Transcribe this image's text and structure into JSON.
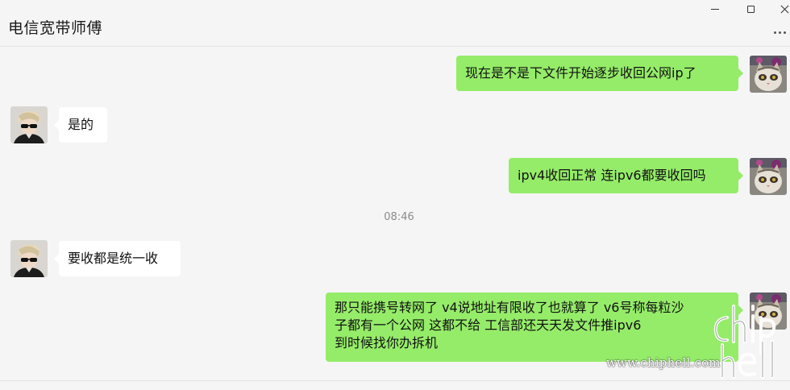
{
  "window": {
    "title": "电信宽带师傅",
    "controls": [
      "minimize-icon",
      "maximize-icon",
      "close-icon"
    ],
    "more_icon": "more-dots-icon"
  },
  "messages": [
    {
      "side": "out",
      "avatar": "cat-avatar",
      "text": "现在是不是下文件开始逐步收回公网ip了"
    },
    {
      "side": "in",
      "avatar": "person-avatar",
      "text": "是的"
    },
    {
      "side": "out",
      "avatar": "cat-avatar",
      "text": "ipv4收回正常 连ipv6都要收回吗"
    },
    {
      "side": "in",
      "avatar": "person-avatar",
      "text": "要收都是统一收"
    },
    {
      "side": "out",
      "avatar": "cat-avatar",
      "lines": [
        "那只能携号转网了 v4说地址有限收了也就算了 v6号称每粒沙",
        "子都有一个公网 这都不给 工信部还天天发文件推ipv6",
        "到时候找你办拆机"
      ]
    }
  ],
  "timestamp": "08:46",
  "watermark": {
    "url": "www.chiphell.com",
    "logo": "chiphell-logo"
  },
  "colors": {
    "background": "#f5f5f5",
    "outgoing_bubble": "#95ec69",
    "incoming_bubble": "#ffffff",
    "timestamp": "#8a8a8a"
  }
}
